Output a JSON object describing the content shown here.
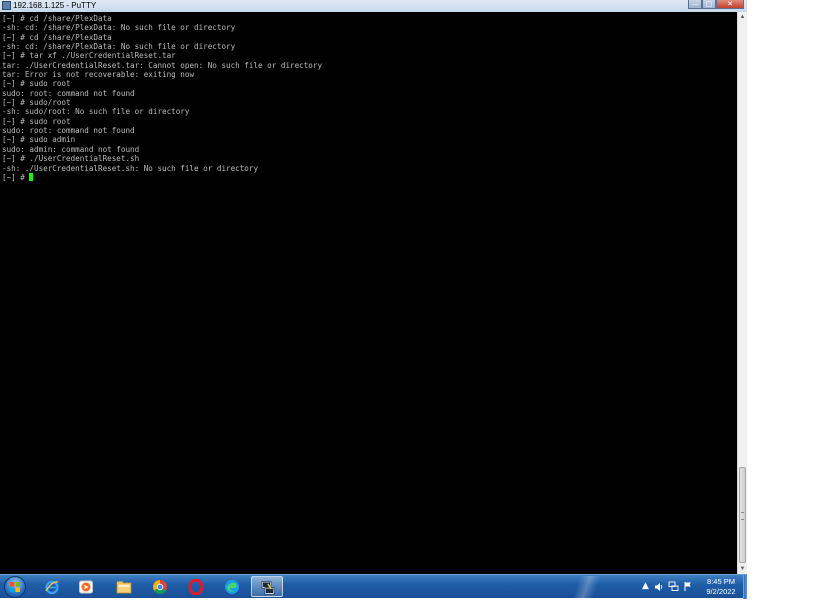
{
  "window": {
    "title": "192.168.1.125 - PuTTY",
    "buttons": {
      "minimize": "—",
      "maximize": "□",
      "close": "✕"
    }
  },
  "terminal": {
    "lines": [
      "[~] # cd /share/PlexData",
      "-sh: cd: /share/PlexData: No such file or directory",
      "[~] # cd /share/PlexData",
      "-sh: cd: /share/PlexData: No such file or directory",
      "[~] # tar xf ./UserCredentialReset.tar",
      "tar: ./UserCredentialReset.tar: Cannot open: No such file or directory",
      "tar: Error is not recoverable: exiting now",
      "[~] # sudo root",
      "sudo: root: command not found",
      "[~] # sudo/root",
      "-sh: sudo/root: No such file or directory",
      "[~] # sudo root",
      "sudo: root: command not found",
      "[~] # sudo admin",
      "sudo: admin: command not found",
      "[~] # ./UserCredentialReset.sh",
      "-sh: ./UserCredentialReset.sh: No such file or directory"
    ],
    "prompt": "[~] # ",
    "text_color": "#bbbbbb",
    "cursor_color": "#00ff00"
  },
  "taskbar": {
    "pinned": [
      {
        "name": "internet-explorer-icon",
        "active": false
      },
      {
        "name": "media-player-icon",
        "active": false
      },
      {
        "name": "file-explorer-icon",
        "active": false
      },
      {
        "name": "chrome-icon",
        "active": false
      },
      {
        "name": "opera-icon",
        "active": false
      },
      {
        "name": "edge-icon",
        "active": false
      },
      {
        "name": "putty-icon",
        "active": true
      }
    ],
    "tray_icons": [
      "chevron-up-icon",
      "speaker-icon",
      "network-icon",
      "flag-icon"
    ],
    "clock_time": "8:45 PM",
    "clock_date": "9/2/2022"
  }
}
